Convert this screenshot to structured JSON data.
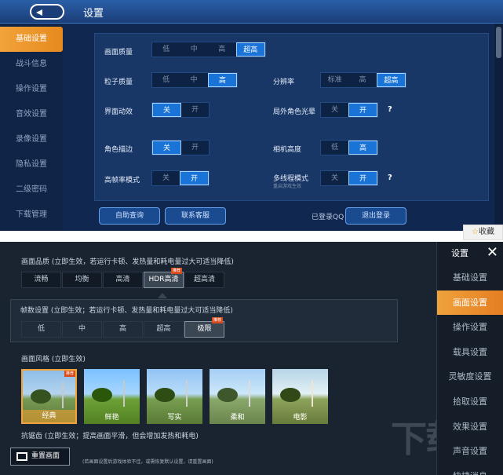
{
  "top": {
    "title": "设置",
    "nav": [
      "基础设置",
      "战斗信息",
      "操作设置",
      "音效设置",
      "录像设置",
      "隐私设置",
      "二级密码",
      "下载管理"
    ],
    "quality": {
      "label": "画面质量",
      "opts": [
        "低",
        "中",
        "高",
        "超高"
      ]
    },
    "particle": {
      "label": "粒子质量",
      "opts": [
        "低",
        "中",
        "高"
      ]
    },
    "resolution": {
      "label": "分辨率",
      "opts": [
        "标准",
        "高",
        "超高"
      ]
    },
    "uifx": {
      "label": "界面动效",
      "opts": [
        "关",
        "开"
      ]
    },
    "outline": {
      "label": "局外角色光晕",
      "opts": [
        "关",
        "开"
      ],
      "q": "?"
    },
    "stroke": {
      "label": "角色描边",
      "opts": [
        "关",
        "开"
      ]
    },
    "camera": {
      "label": "相机高度",
      "opts": [
        "低",
        "高"
      ]
    },
    "hfr": {
      "label": "高帧率模式",
      "opts": [
        "关",
        "开"
      ]
    },
    "thread": {
      "label": "多线程模式",
      "sub": "重启游戏生效",
      "opts": [
        "关",
        "开"
      ],
      "q": "?"
    },
    "btn_help": "自助查询",
    "btn_service": "联系客服",
    "login": "已登录QQ",
    "btn_logout": "退出登录",
    "fav": "收藏"
  },
  "bottom": {
    "quality_label": "画面品质 (立即生效，若运行卡顿、发热量和耗电量过大可适当降低)",
    "quality_opts": [
      "流畅",
      "均衡",
      "高清",
      "HDR高清",
      "超高清"
    ],
    "tag": "推荐",
    "fps_label": "帧数设置 (立即生效；若运行卡顿、发热量和耗电量过大可适当降低)",
    "fps_opts": [
      "低",
      "中",
      "高",
      "超高",
      "极限"
    ],
    "fps_tag": "推荐",
    "style_label": "画面风格 (立即生效)",
    "style_opts": [
      "经典",
      "鲜艳",
      "写实",
      "柔和",
      "电影"
    ],
    "style_tag": "推荐",
    "aa_label": "抗锯齿 (立即生效；提高画面平滑，但会增加发热和耗电)",
    "reset": "重置画面",
    "note": "(若画面设置后游戏体验不佳，或需恢复默认设置，请重置画面)",
    "nav_title": "设置",
    "close": "✕",
    "nav": [
      "基础设置",
      "画面设置",
      "操作设置",
      "载具设置",
      "灵敏度设置",
      "拾取设置",
      "效果设置",
      "声音设置",
      "快捷消息"
    ],
    "wm": "下载吧"
  }
}
